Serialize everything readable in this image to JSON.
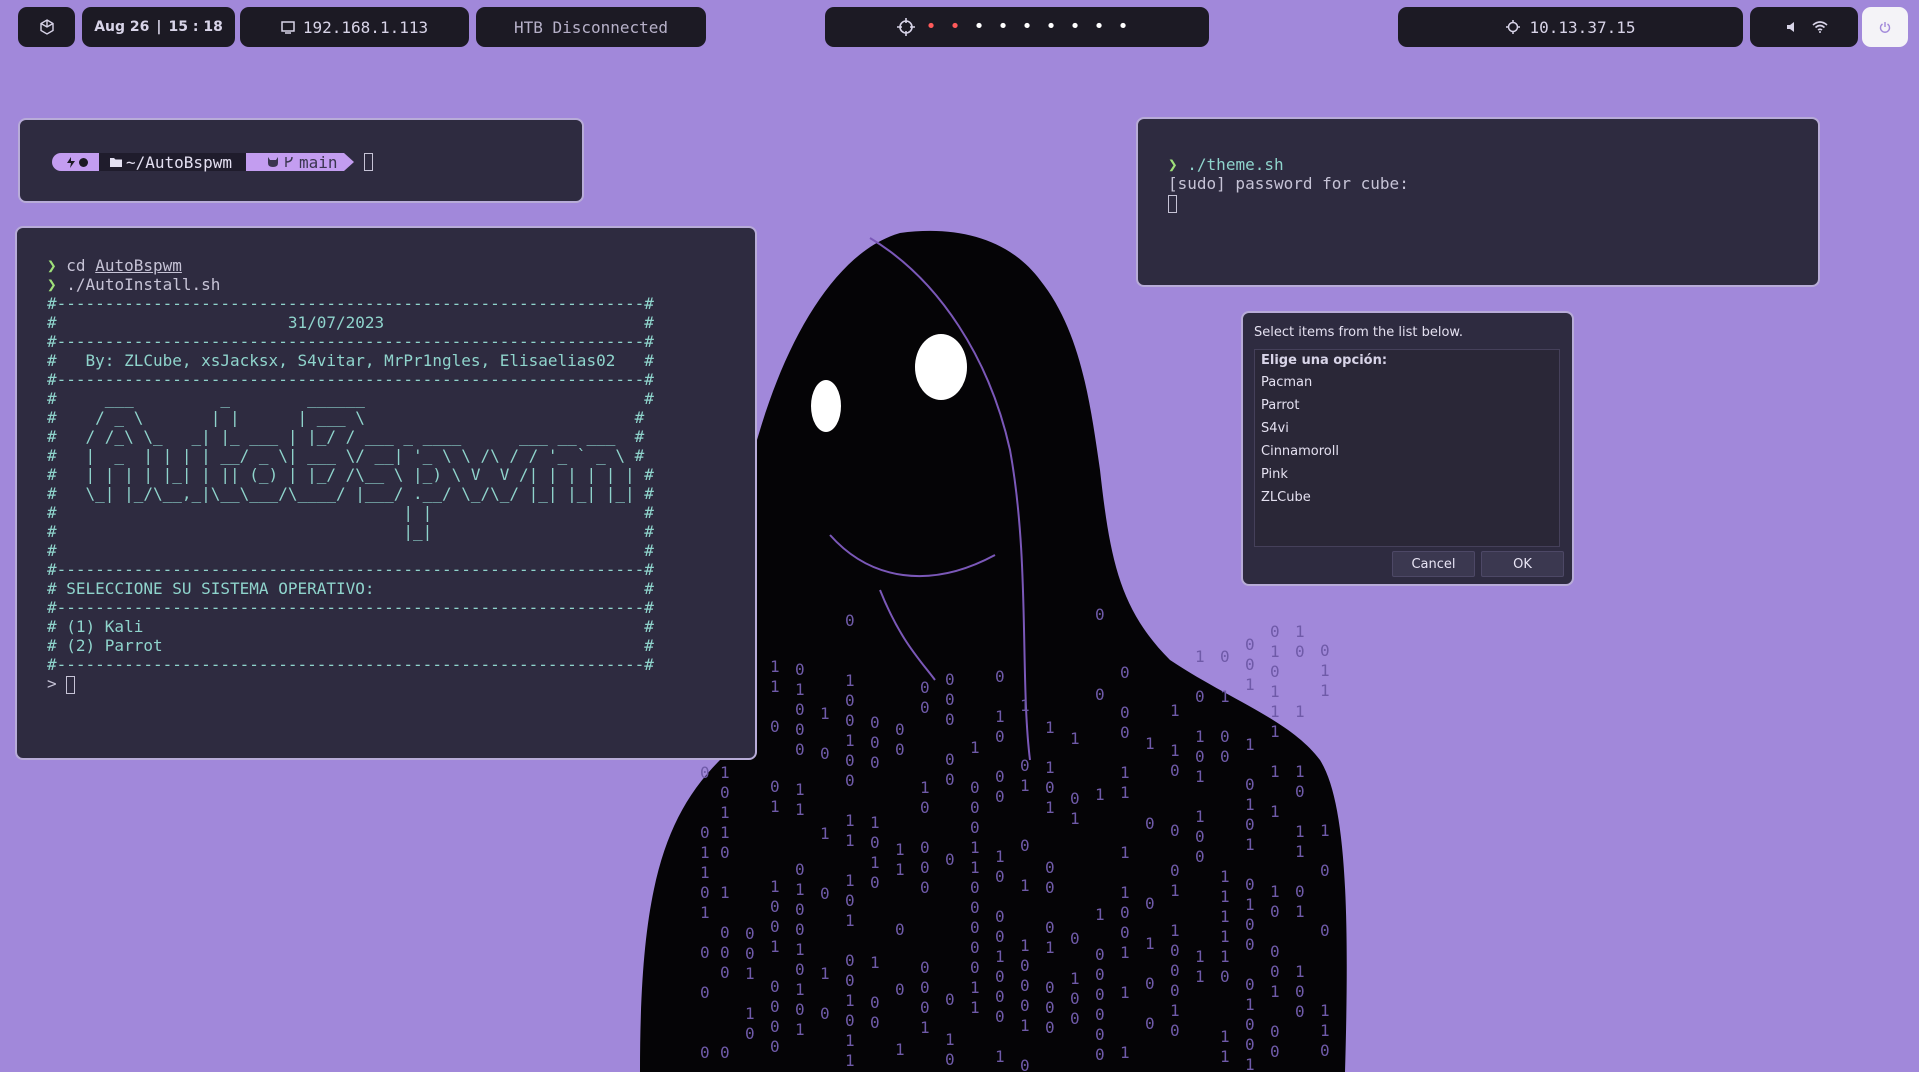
{
  "topbar": {
    "date": "Aug 26",
    "time_sep": "|",
    "time": "15 : 18",
    "local_ip": "192.168.1.113",
    "htb_status": "HTB Disconnected",
    "workspaces": [
      "•",
      "•",
      "•",
      "•",
      "•",
      "•",
      "•",
      "•",
      "•"
    ],
    "workspace_colors": [
      "#ff5a5a",
      "#ff5a5a",
      "#ffffff",
      "#ffffff",
      "#ffffff",
      "#ffffff",
      "#ffffff",
      "#ffffff",
      "#ffffff"
    ],
    "vpn_ip": "10.13.37.15",
    "icons": [
      "cube-icon",
      "monitor-icon",
      "crosshair-icon",
      "target-icon",
      "volume-icon",
      "wifi-icon",
      "power-icon"
    ]
  },
  "prompt_terminal": {
    "segment_dir": "~/AutoBspwm",
    "segment_git": "main",
    "icons": [
      "bolt-icon",
      "folder-icon",
      "github-icon",
      "branch-icon"
    ]
  },
  "install_terminal": {
    "cmd1_arrow": "❯",
    "cmd1_prefix": "cd ",
    "cmd1_arg": "AutoBspwm",
    "cmd2_arrow": "❯",
    "cmd2": "./AutoInstall.sh",
    "banner": [
      "#-------------------------------------------------------------#",
      "#                        31/07/2023                           #",
      "#-------------------------------------------------------------#",
      "#   By: ZLCube, xsJacksx, S4vitar, MrPr1ngles, Elisaelias02   #",
      "#-------------------------------------------------------------#",
      "#     ___         _        ______                             #",
      "#    / _ \\       | |      | ___ \\                            #",
      "#   / /_\\ \\_   _| |_ ___ | |_/ / ___ _ ____      ___ __ ___  #",
      "#   |  _  | | | | __/ _ \\| ___ \\/ __| '_ \\ \\ /\\ / / '_ ` _ \\ #",
      "#   | | | | |_| | || (_) | |_/ /\\__ \\ |_) \\ V  V /| | | | | | #",
      "#   \\_| |_/\\__,_|\\__\\___/\\____/ |___/ .__/ \\_/\\_/ |_| |_| |_| #",
      "#                                    | |                      #",
      "#                                    |_|                      #",
      "#                                                             #",
      "#-------------------------------------------------------------#",
      "# SELECCIONE SU SISTEMA OPERATIVO:                            #",
      "#-------------------------------------------------------------#",
      "# (1) Kali                                                    #",
      "# (2) Parrot                                                  #",
      "#-------------------------------------------------------------#"
    ],
    "input_prompt": "> "
  },
  "theme_terminal": {
    "arrow": "❯",
    "command": "./theme.sh",
    "sudo_prompt": "[sudo] password for cube:"
  },
  "dialog": {
    "message": "Select items from the list below.",
    "list_header": "Elige una opción:",
    "items": [
      "Pacman",
      "Parrot",
      "S4vi",
      "Cinnamoroll",
      "Pink",
      "ZLCube"
    ],
    "cancel_label": "Cancel",
    "ok_label": "OK"
  },
  "colors": {
    "background": "#a188da",
    "bar": "#1c1a24",
    "terminal": "#2e2b40",
    "accent": "#c39df0",
    "prompt_green": "#9fe07a",
    "banner_teal": "#8fd4cc"
  }
}
